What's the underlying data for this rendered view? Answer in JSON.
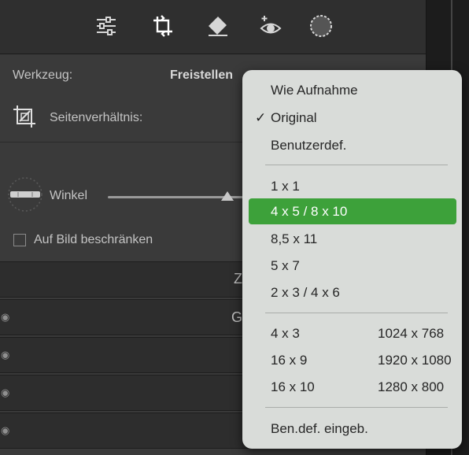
{
  "toolbar": {
    "icons": [
      "sliders-icon",
      "crop-icon",
      "eraser-icon",
      "red-eye-icon",
      "masking-icon"
    ]
  },
  "panel": {
    "tool_label": "Werkzeug:",
    "tool_value": "Freistellen",
    "aspect_label": "Seitenverhältnis:",
    "angle_label": "Winkel",
    "constrain_label": "Auf Bild beschränken",
    "band_letter_1": "Z",
    "band_letter_2": "G"
  },
  "menu": {
    "group1": [
      {
        "label": "Wie Aufnahme",
        "checked": false
      },
      {
        "label": "Original",
        "checked": true
      },
      {
        "label": "Benutzerdef.",
        "checked": false
      }
    ],
    "check_mark": "✓",
    "group2": [
      "1 x 1",
      "4 x 5 / 8 x 10",
      "8,5 x 11",
      "5 x 7",
      "2 x 3 / 4 x 6"
    ],
    "highlighted": "4 x 5 / 8 x 10",
    "group3": [
      {
        "ratio": "4 x 3",
        "resolution": "1024 x 768"
      },
      {
        "ratio": "16 x 9",
        "resolution": "1920 x 1080"
      },
      {
        "ratio": "16 x 10",
        "resolution": "1280 x 800"
      }
    ],
    "custom_entry": "Ben.def. eingeb."
  },
  "colors": {
    "highlight": "#3da13a",
    "menu_bg": "#d9dcd9",
    "panel_bg": "#3a3a3a"
  }
}
